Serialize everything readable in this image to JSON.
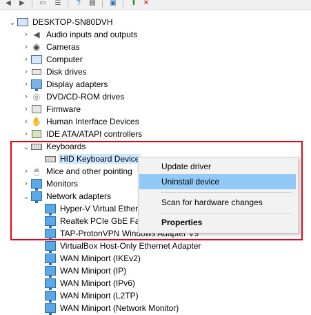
{
  "toolbar": {
    "icons": [
      "back-arrow-icon",
      "forward-arrow-icon",
      "window-icon",
      "list-icon",
      "help-icon",
      "properties-icon",
      "monitor-icon",
      "update-driver-icon",
      "uninstall-x-icon"
    ]
  },
  "tree": {
    "root": "DESKTOP-SN80DVH",
    "categories": [
      {
        "label": "Audio inputs and outputs",
        "icon": "speaker-icon"
      },
      {
        "label": "Cameras",
        "icon": "camera-icon"
      },
      {
        "label": "Computer",
        "icon": "computer-icon"
      },
      {
        "label": "Disk drives",
        "icon": "disk-icon"
      },
      {
        "label": "Display adapters",
        "icon": "display-icon"
      },
      {
        "label": "DVD/CD-ROM drives",
        "icon": "dvd-icon"
      },
      {
        "label": "Firmware",
        "icon": "firmware-icon"
      },
      {
        "label": "Human Interface Devices",
        "icon": "hid-icon"
      },
      {
        "label": "IDE ATA/ATAPI controllers",
        "icon": "ide-icon"
      }
    ],
    "keyboards": {
      "label": "Keyboards",
      "child": "HID Keyboard Device"
    },
    "mice": "Mice and other pointing",
    "monitors": "Monitors",
    "network": {
      "label": "Network adapters",
      "children": [
        "Hyper-V Virtual Ether",
        "Realtek PCIe GbE Fan",
        "TAP-ProtonVPN Windows Adapter V9",
        "VirtualBox Host-Only Ethernet Adapter",
        "WAN Miniport (IKEv2)",
        "WAN Miniport (IP)",
        "WAN Miniport (IPv6)",
        "WAN Miniport (L2TP)",
        "WAN Miniport (Network Monitor)"
      ]
    }
  },
  "context_menu": {
    "update_driver": "Update driver",
    "uninstall_device": "Uninstall device",
    "scan_hardware": "Scan for hardware changes",
    "properties": "Properties"
  },
  "colors": {
    "highlight_box": "#e60012",
    "menu_hover": "#91c9f7",
    "selection": "#cce8ff"
  }
}
